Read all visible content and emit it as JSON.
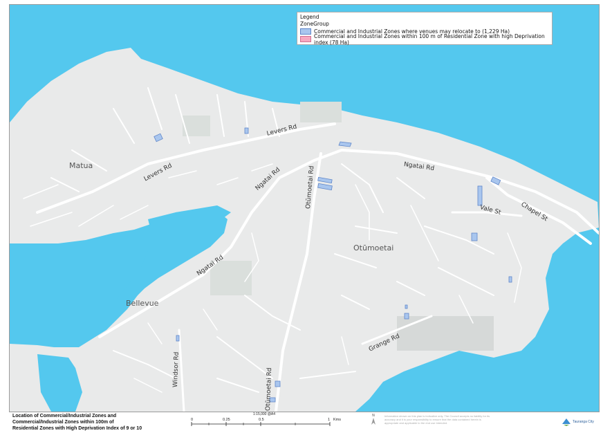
{
  "legend": {
    "title": "Legend",
    "group": "ZoneGroup",
    "items": [
      {
        "label": "Commercial and Industrial Zones where venues may relocate to (1,229 Ha)",
        "color": "#a9c6ee",
        "border": "#5f86c8"
      },
      {
        "label": "Commercial and Industrial Zones within 100 m of Residential Zone with high Deprivation index (78 Ha)",
        "color": "#f7a8c0",
        "border": "#d07090"
      }
    ]
  },
  "places": {
    "matua": "Matua",
    "bellevue": "Bellevue",
    "otumoetai": "Otūmoetai"
  },
  "roads": {
    "levers_rd_1": "Levers Rd",
    "levers_rd_2": "Levers Rd",
    "ngatai_rd_1": "Ngatai Rd",
    "ngatai_rd_2": "Ngatai Rd",
    "ngatai_rd_3": "Ngatai Rd",
    "otumoetai_rd_1": "Otūmoetai Rd",
    "otumoetai_rd_2": "Otūmoetai Rd",
    "vale_st": "Vale St",
    "chapel_st": "Chapel St",
    "grange_rd": "Grange Rd",
    "windsor_rd": "Windsor Rd"
  },
  "footer": {
    "title_line1": "Location of Commercial/Industrial Zones and",
    "title_line2": "Commercial/Industrial Zones within 100m of",
    "title_line3": "Residential Zones with High Deprivation Index of 9 or 10",
    "scale_ratio": "1:15,000 @A4",
    "scale_ticks": [
      "0",
      "0.25",
      "0.5",
      "1"
    ],
    "scale_unit": "Kms",
    "north": "N",
    "disclaimer": "Information shown on this plan is indicative only. The Council accepts no liability for its accuracy and it is your responsibility to ensure that the data contained herein is appropriate and applicable to the end use intended.",
    "logo_text": "Tauranga City"
  },
  "colors": {
    "water": "#54c8ee",
    "land": "#e9eaea",
    "road": "#ffffff",
    "park": "#d9dedb",
    "zone_fill": "#a9c6ee",
    "zone_border": "#5f86c8"
  }
}
